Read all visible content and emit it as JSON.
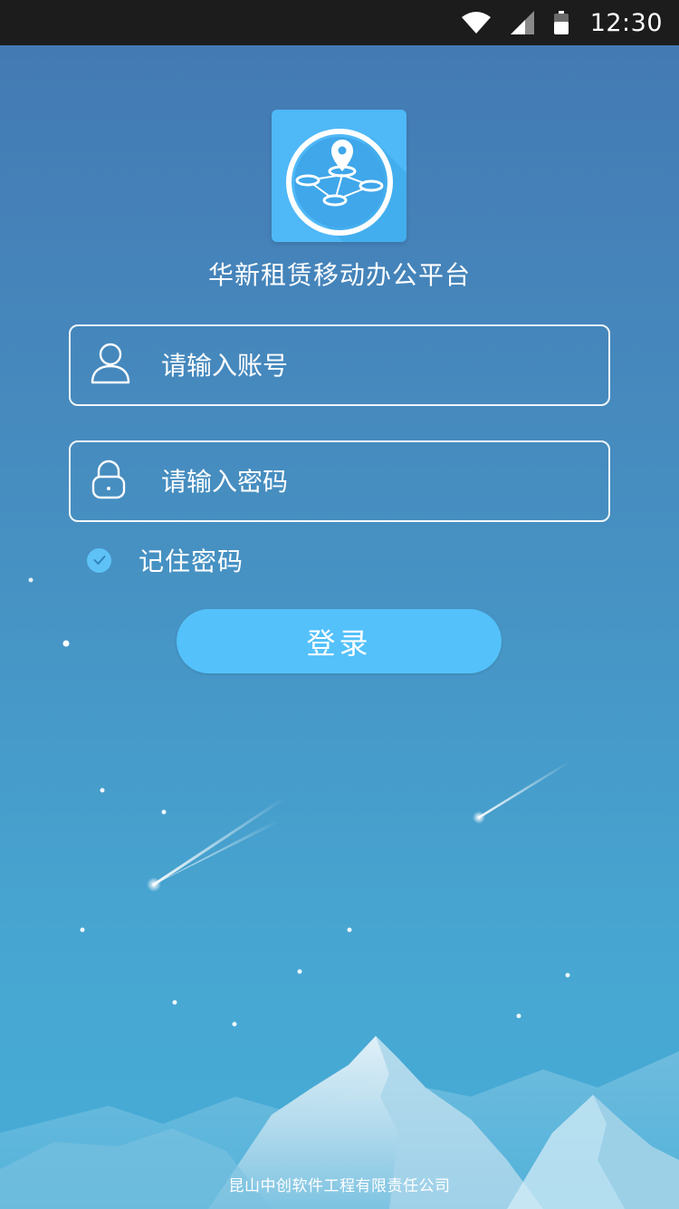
{
  "status_bar": {
    "time": "12:30",
    "icons": [
      "wifi-icon",
      "cell-signal-icon",
      "battery-icon"
    ]
  },
  "app": {
    "title": "华新租赁移动办公平台",
    "logo_icon": "location-network-icon",
    "accent_color": "#4fb8f7"
  },
  "form": {
    "username": {
      "value": "",
      "placeholder": "请输入账号",
      "icon": "user-icon"
    },
    "password": {
      "value": "",
      "placeholder": "请输入密码",
      "icon": "lock-icon"
    },
    "remember": {
      "label": "记住密码",
      "checked": true
    },
    "login_label": "登录",
    "button_color": "#54c1fa"
  },
  "footer": {
    "company": "昆山中创软件工程有限责任公司"
  }
}
